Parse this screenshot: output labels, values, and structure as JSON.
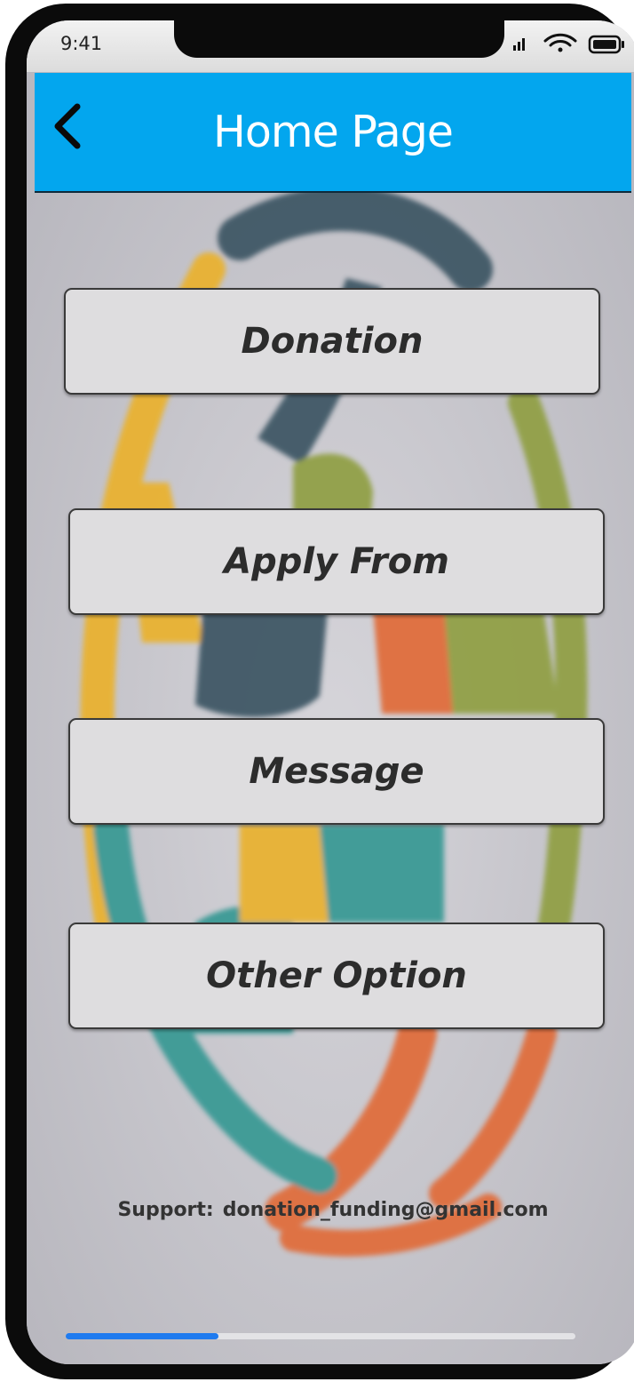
{
  "status_bar": {
    "time": "9:41",
    "icons": [
      "signal-icon",
      "wifi-icon",
      "battery-icon"
    ]
  },
  "header": {
    "title": "Home Page",
    "back_icon": "chevron-left-icon",
    "background_color": "#03a6ee"
  },
  "menu": {
    "items": [
      {
        "label": "Donation"
      },
      {
        "label": "Apply From"
      },
      {
        "label": "Message"
      },
      {
        "label": "Other Option"
      }
    ]
  },
  "footer": {
    "support_label": "Support:",
    "support_email": "donation_funding@gmail.com"
  },
  "progress": {
    "fraction": 0.3
  },
  "colors": {
    "accent_blue": "#03a6ee",
    "progress_blue": "#1f7bef",
    "logo_yellow": "#e9b233",
    "logo_slate": "#3f5966",
    "logo_olive": "#92a046",
    "logo_orange": "#e06e3e",
    "logo_teal": "#3a9a95"
  }
}
